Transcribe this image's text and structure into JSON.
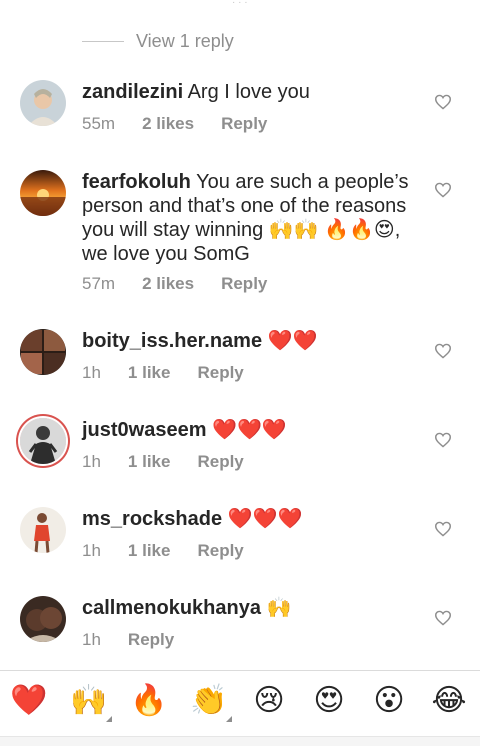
{
  "top_fragment": "· · ·",
  "view_reply": {
    "label": "View 1 reply"
  },
  "comments": [
    {
      "username": "zandilezini",
      "text": "Arg I love you",
      "time": "55m",
      "likes": "2 likes",
      "reply": "Reply"
    },
    {
      "username": "fearfokoluh",
      "text": "You are such a people’s person and that’s one of the reasons you will stay winning 🙌🙌 🔥🔥😍, we love you SomG",
      "time": "57m",
      "likes": "2 likes",
      "reply": "Reply"
    },
    {
      "username": "boity_iss.her.name",
      "text": "❤️❤️",
      "time": "1h",
      "likes": "1 like",
      "reply": "Reply"
    },
    {
      "username": "just0waseem",
      "text": "❤️❤️❤️",
      "time": "1h",
      "likes": "1 like",
      "reply": "Reply"
    },
    {
      "username": "ms_rockshade",
      "text": "❤️❤️❤️",
      "time": "1h",
      "likes": "1 like",
      "reply": "Reply"
    },
    {
      "username": "callmenokukhanya",
      "text": "🙌",
      "time": "1h",
      "likes": "",
      "reply": "Reply"
    }
  ],
  "emoji_bar": [
    "❤️",
    "🙌",
    "🔥",
    "👏",
    "😢",
    "😍",
    "😮",
    "😂"
  ],
  "colors": {
    "username": "#262626",
    "meta": "#8e8e8e",
    "heart_outline": "#8e8e8e",
    "story_ring": "#d9534f"
  }
}
